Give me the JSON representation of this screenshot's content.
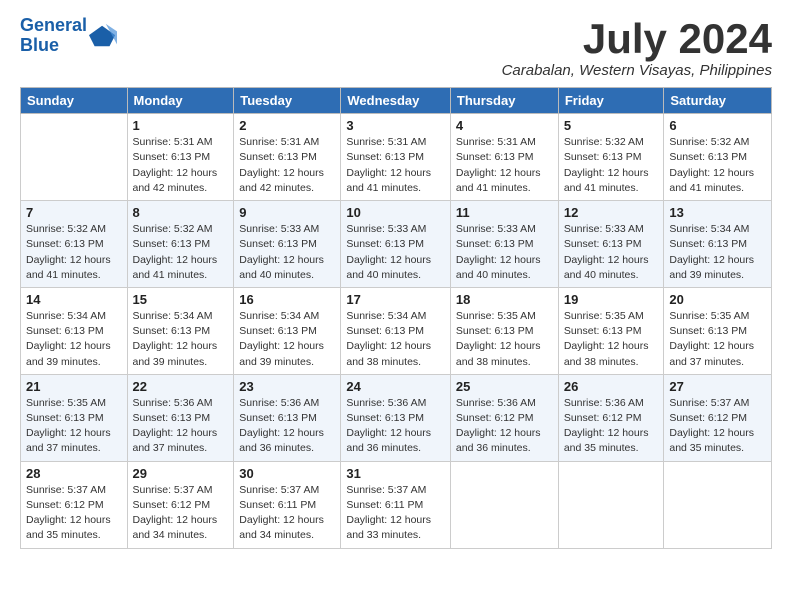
{
  "logo": {
    "text_general": "General",
    "text_blue": "Blue"
  },
  "header": {
    "month": "July 2024",
    "location": "Carabalan, Western Visayas, Philippines"
  },
  "weekdays": [
    "Sunday",
    "Monday",
    "Tuesday",
    "Wednesday",
    "Thursday",
    "Friday",
    "Saturday"
  ],
  "weeks": [
    [
      {
        "day": "",
        "sunrise": "",
        "sunset": "",
        "daylight": ""
      },
      {
        "day": "1",
        "sunrise": "Sunrise: 5:31 AM",
        "sunset": "Sunset: 6:13 PM",
        "daylight": "Daylight: 12 hours and 42 minutes."
      },
      {
        "day": "2",
        "sunrise": "Sunrise: 5:31 AM",
        "sunset": "Sunset: 6:13 PM",
        "daylight": "Daylight: 12 hours and 42 minutes."
      },
      {
        "day": "3",
        "sunrise": "Sunrise: 5:31 AM",
        "sunset": "Sunset: 6:13 PM",
        "daylight": "Daylight: 12 hours and 41 minutes."
      },
      {
        "day": "4",
        "sunrise": "Sunrise: 5:31 AM",
        "sunset": "Sunset: 6:13 PM",
        "daylight": "Daylight: 12 hours and 41 minutes."
      },
      {
        "day": "5",
        "sunrise": "Sunrise: 5:32 AM",
        "sunset": "Sunset: 6:13 PM",
        "daylight": "Daylight: 12 hours and 41 minutes."
      },
      {
        "day": "6",
        "sunrise": "Sunrise: 5:32 AM",
        "sunset": "Sunset: 6:13 PM",
        "daylight": "Daylight: 12 hours and 41 minutes."
      }
    ],
    [
      {
        "day": "7",
        "sunrise": "Sunrise: 5:32 AM",
        "sunset": "Sunset: 6:13 PM",
        "daylight": "Daylight: 12 hours and 41 minutes."
      },
      {
        "day": "8",
        "sunrise": "Sunrise: 5:32 AM",
        "sunset": "Sunset: 6:13 PM",
        "daylight": "Daylight: 12 hours and 41 minutes."
      },
      {
        "day": "9",
        "sunrise": "Sunrise: 5:33 AM",
        "sunset": "Sunset: 6:13 PM",
        "daylight": "Daylight: 12 hours and 40 minutes."
      },
      {
        "day": "10",
        "sunrise": "Sunrise: 5:33 AM",
        "sunset": "Sunset: 6:13 PM",
        "daylight": "Daylight: 12 hours and 40 minutes."
      },
      {
        "day": "11",
        "sunrise": "Sunrise: 5:33 AM",
        "sunset": "Sunset: 6:13 PM",
        "daylight": "Daylight: 12 hours and 40 minutes."
      },
      {
        "day": "12",
        "sunrise": "Sunrise: 5:33 AM",
        "sunset": "Sunset: 6:13 PM",
        "daylight": "Daylight: 12 hours and 40 minutes."
      },
      {
        "day": "13",
        "sunrise": "Sunrise: 5:34 AM",
        "sunset": "Sunset: 6:13 PM",
        "daylight": "Daylight: 12 hours and 39 minutes."
      }
    ],
    [
      {
        "day": "14",
        "sunrise": "Sunrise: 5:34 AM",
        "sunset": "Sunset: 6:13 PM",
        "daylight": "Daylight: 12 hours and 39 minutes."
      },
      {
        "day": "15",
        "sunrise": "Sunrise: 5:34 AM",
        "sunset": "Sunset: 6:13 PM",
        "daylight": "Daylight: 12 hours and 39 minutes."
      },
      {
        "day": "16",
        "sunrise": "Sunrise: 5:34 AM",
        "sunset": "Sunset: 6:13 PM",
        "daylight": "Daylight: 12 hours and 39 minutes."
      },
      {
        "day": "17",
        "sunrise": "Sunrise: 5:34 AM",
        "sunset": "Sunset: 6:13 PM",
        "daylight": "Daylight: 12 hours and 38 minutes."
      },
      {
        "day": "18",
        "sunrise": "Sunrise: 5:35 AM",
        "sunset": "Sunset: 6:13 PM",
        "daylight": "Daylight: 12 hours and 38 minutes."
      },
      {
        "day": "19",
        "sunrise": "Sunrise: 5:35 AM",
        "sunset": "Sunset: 6:13 PM",
        "daylight": "Daylight: 12 hours and 38 minutes."
      },
      {
        "day": "20",
        "sunrise": "Sunrise: 5:35 AM",
        "sunset": "Sunset: 6:13 PM",
        "daylight": "Daylight: 12 hours and 37 minutes."
      }
    ],
    [
      {
        "day": "21",
        "sunrise": "Sunrise: 5:35 AM",
        "sunset": "Sunset: 6:13 PM",
        "daylight": "Daylight: 12 hours and 37 minutes."
      },
      {
        "day": "22",
        "sunrise": "Sunrise: 5:36 AM",
        "sunset": "Sunset: 6:13 PM",
        "daylight": "Daylight: 12 hours and 37 minutes."
      },
      {
        "day": "23",
        "sunrise": "Sunrise: 5:36 AM",
        "sunset": "Sunset: 6:13 PM",
        "daylight": "Daylight: 12 hours and 36 minutes."
      },
      {
        "day": "24",
        "sunrise": "Sunrise: 5:36 AM",
        "sunset": "Sunset: 6:13 PM",
        "daylight": "Daylight: 12 hours and 36 minutes."
      },
      {
        "day": "25",
        "sunrise": "Sunrise: 5:36 AM",
        "sunset": "Sunset: 6:12 PM",
        "daylight": "Daylight: 12 hours and 36 minutes."
      },
      {
        "day": "26",
        "sunrise": "Sunrise: 5:36 AM",
        "sunset": "Sunset: 6:12 PM",
        "daylight": "Daylight: 12 hours and 35 minutes."
      },
      {
        "day": "27",
        "sunrise": "Sunrise: 5:37 AM",
        "sunset": "Sunset: 6:12 PM",
        "daylight": "Daylight: 12 hours and 35 minutes."
      }
    ],
    [
      {
        "day": "28",
        "sunrise": "Sunrise: 5:37 AM",
        "sunset": "Sunset: 6:12 PM",
        "daylight": "Daylight: 12 hours and 35 minutes."
      },
      {
        "day": "29",
        "sunrise": "Sunrise: 5:37 AM",
        "sunset": "Sunset: 6:12 PM",
        "daylight": "Daylight: 12 hours and 34 minutes."
      },
      {
        "day": "30",
        "sunrise": "Sunrise: 5:37 AM",
        "sunset": "Sunset: 6:11 PM",
        "daylight": "Daylight: 12 hours and 34 minutes."
      },
      {
        "day": "31",
        "sunrise": "Sunrise: 5:37 AM",
        "sunset": "Sunset: 6:11 PM",
        "daylight": "Daylight: 12 hours and 33 minutes."
      },
      {
        "day": "",
        "sunrise": "",
        "sunset": "",
        "daylight": ""
      },
      {
        "day": "",
        "sunrise": "",
        "sunset": "",
        "daylight": ""
      },
      {
        "day": "",
        "sunrise": "",
        "sunset": "",
        "daylight": ""
      }
    ]
  ]
}
